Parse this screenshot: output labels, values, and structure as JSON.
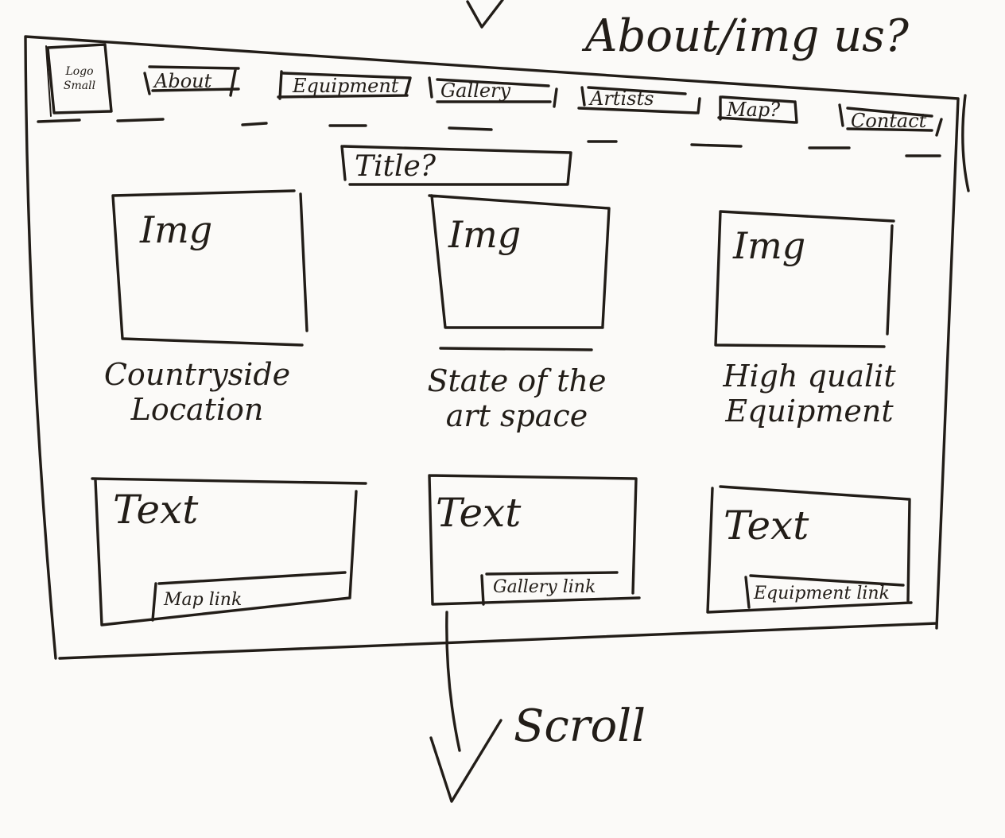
{
  "top_note": "About/img us?",
  "logo": "Logo Small",
  "nav": {
    "items": [
      {
        "label": "About"
      },
      {
        "label": "Equipment"
      },
      {
        "label": "Gallery"
      },
      {
        "label": "Artists"
      },
      {
        "label": "Map?"
      },
      {
        "label": "Contact"
      }
    ]
  },
  "title": "Title?",
  "features": [
    {
      "image": "Img",
      "caption": "Countryside Location"
    },
    {
      "image": "Img",
      "caption": "State of the art space"
    },
    {
      "image": "Img",
      "caption": "High qualit Equipment"
    }
  ],
  "text_blocks": [
    {
      "text": "Text",
      "link": "Map link"
    },
    {
      "text": "Text",
      "link": "Gallery link"
    },
    {
      "text": "Text",
      "link": "Equipment link"
    }
  ],
  "scroll_label": "Scroll"
}
